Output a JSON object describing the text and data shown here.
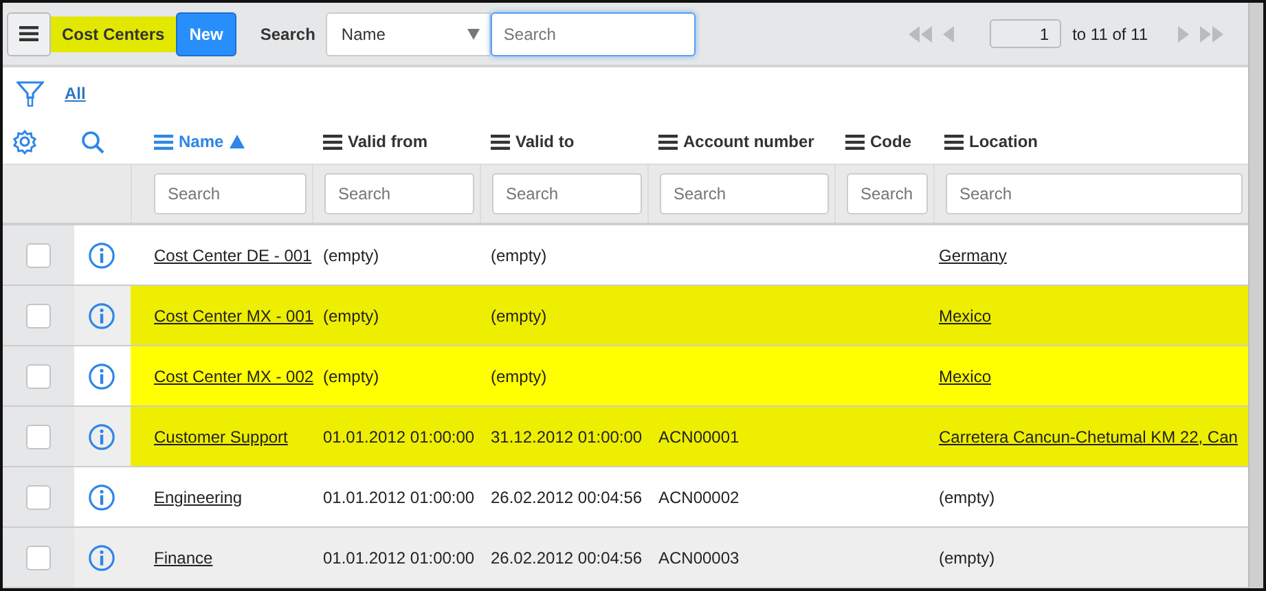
{
  "header": {
    "title": "Cost Centers",
    "new_button": "New",
    "search_label": "Search",
    "search_field": {
      "value": "Name"
    },
    "search_input": {
      "placeholder": "Search"
    },
    "pager": {
      "page": "1",
      "range": "to 11 of 11"
    }
  },
  "filter": {
    "link": "All"
  },
  "columns": [
    {
      "label": "Name",
      "sorted": true,
      "placeholder": "Search"
    },
    {
      "label": "Valid from",
      "sorted": false,
      "placeholder": "Search"
    },
    {
      "label": "Valid to",
      "sorted": false,
      "placeholder": "Search"
    },
    {
      "label": "Account number",
      "sorted": false,
      "placeholder": "Search"
    },
    {
      "label": "Code",
      "sorted": false,
      "placeholder": "Search"
    },
    {
      "label": "Location",
      "sorted": false,
      "placeholder": "Search"
    }
  ],
  "rows": [
    {
      "checked": false,
      "highlighted": false,
      "name": "Cost Center DE - 001",
      "valid_from": "(empty)",
      "valid_to": "(empty)",
      "location": "Germany",
      "location_link": true
    },
    {
      "checked": false,
      "highlighted": true,
      "name": "Cost Center MX - 001",
      "valid_from": "(empty)",
      "valid_to": "(empty)",
      "location": "Mexico",
      "location_link": true
    },
    {
      "checked": false,
      "highlighted": true,
      "name": "Cost Center MX - 002",
      "valid_from": "(empty)",
      "valid_to": "(empty)",
      "location": "Mexico",
      "location_link": true
    },
    {
      "checked": false,
      "highlighted": true,
      "name": "Customer Support",
      "valid_from": "01.01.2012 01:00:00",
      "valid_to": "31.12.2012 01:00:00",
      "account_number": "ACN00001",
      "location": "Carretera Cancun-Chetumal KM 22, Can",
      "location_link": true
    },
    {
      "checked": false,
      "highlighted": false,
      "name": "Engineering",
      "valid_from": "01.01.2012 01:00:00",
      "valid_to": "26.02.2012 00:04:56",
      "account_number": "ACN00002",
      "location": "(empty)",
      "location_link": false
    },
    {
      "checked": false,
      "highlighted": false,
      "name": "Finance",
      "valid_from": "01.01.2012 01:00:00",
      "valid_to": "26.02.2012 00:04:56",
      "account_number": "ACN00003",
      "location": "(empty)",
      "location_link": false
    }
  ]
}
